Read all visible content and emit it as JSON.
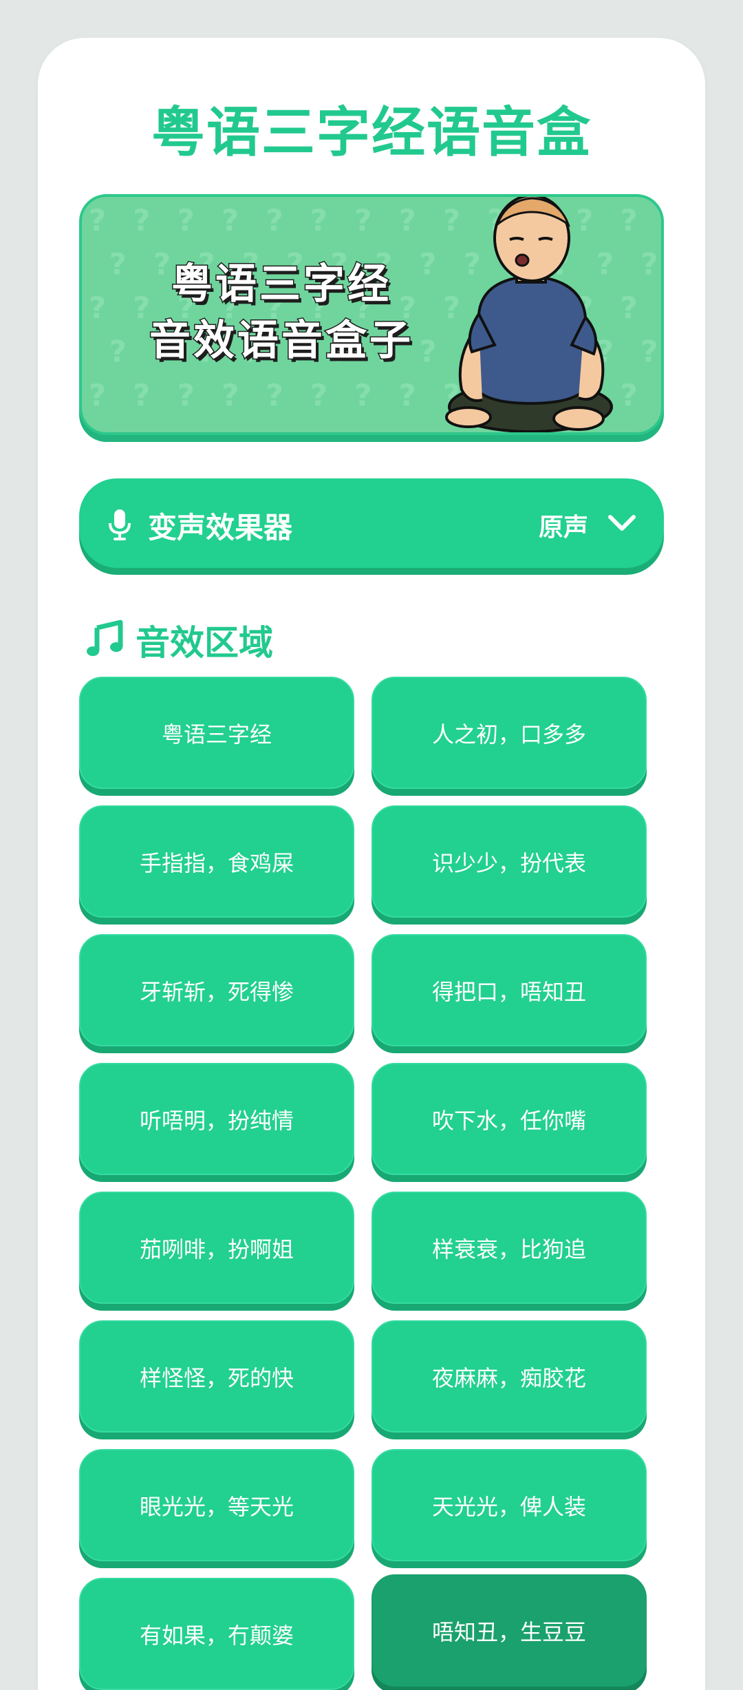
{
  "app": {
    "title": "粤语三字经语音盒"
  },
  "banner": {
    "line1": "粤语三字经",
    "line2": "音效语音盒子"
  },
  "voice_changer": {
    "icon": "microphone-icon",
    "label": "变声效果器",
    "value": "原声"
  },
  "section": {
    "icon": "music-note-icon",
    "title": "音效区域"
  },
  "colors": {
    "accent": "#22d090",
    "accent_dark": "#1aa16d",
    "title": "#22c98e"
  },
  "sounds": [
    {
      "label": "粤语三字经"
    },
    {
      "label": "人之初，口多多"
    },
    {
      "label": "手指指，食鸡屎"
    },
    {
      "label": "识少少，扮代表"
    },
    {
      "label": "牙斩斩，死得惨"
    },
    {
      "label": "得把口，唔知丑"
    },
    {
      "label": "听唔明，扮纯情"
    },
    {
      "label": "吹下水，任你嘴"
    },
    {
      "label": "茄咧啡，扮啊姐"
    },
    {
      "label": "样衰衰，比狗追"
    },
    {
      "label": "样怪怪，死的快"
    },
    {
      "label": "夜麻麻，痴胶花"
    },
    {
      "label": "眼光光，等天光"
    },
    {
      "label": "天光光，俾人装"
    },
    {
      "label": "有如果，冇颠婆"
    },
    {
      "label": "唔知丑，生豆豆",
      "active": true
    }
  ]
}
